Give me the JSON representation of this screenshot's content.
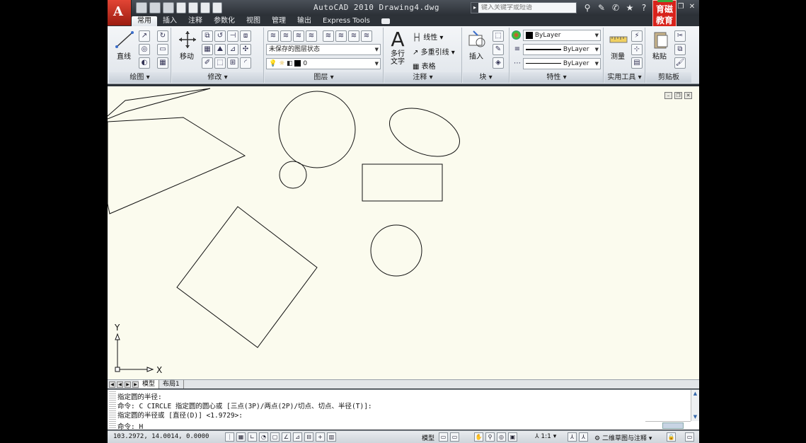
{
  "window": {
    "title": "AutoCAD 2010  Drawing4.dwg",
    "search_placeholder": "键入关键字或短语",
    "brand_logo_text": [
      "育",
      "磁",
      "教",
      "育"
    ]
  },
  "ribbon": {
    "tabs": [
      {
        "label": "常用",
        "active": true
      },
      {
        "label": "插入"
      },
      {
        "label": "注释"
      },
      {
        "label": "参数化"
      },
      {
        "label": "视图"
      },
      {
        "label": "管理"
      },
      {
        "label": "输出"
      },
      {
        "label": "Express Tools"
      }
    ],
    "panels": {
      "draw": {
        "title": "绘图",
        "line_label": "直线"
      },
      "modify": {
        "title": "修改",
        "move_label": "移动"
      },
      "layers": {
        "title": "图层",
        "layer_state": "未保存的图层状态",
        "current_layer": "0"
      },
      "annotation": {
        "title": "注释",
        "mtext_label": "多行\n文字",
        "mtext_line1": "多行",
        "mtext_line2": "文字",
        "linear_label": "线性",
        "mleader_label": "多重引线",
        "table_label": "表格"
      },
      "block": {
        "title": "块",
        "insert_label": "插入"
      },
      "properties": {
        "title": "特性",
        "color": "ByLayer",
        "linetype": "ByLayer",
        "lineweight": "ByLayer"
      },
      "utilities": {
        "title": "实用工具",
        "measure_label": "测量"
      },
      "clipboard": {
        "title": "剪贴板",
        "paste_label": "粘贴"
      }
    }
  },
  "drawing": {
    "ucs_y": "Y",
    "ucs_x": "X"
  },
  "layout_tabs": [
    {
      "label": "模型",
      "active": true
    },
    {
      "label": "布局1"
    }
  ],
  "command": {
    "lines": [
      "指定圆的半径:",
      "命令: C CIRCLE 指定圆的圆心或 [三点(3P)/两点(2P)/切点、切点、半径(T)]:",
      "指定圆的半径或 [直径(D)] <1.9729>:",
      "命令: H"
    ]
  },
  "status": {
    "coords": "103.2972, 14.0014, 0.0000",
    "model_label": "模型",
    "scale_label": "1:1",
    "workspace_label": "二维草图与注释"
  }
}
